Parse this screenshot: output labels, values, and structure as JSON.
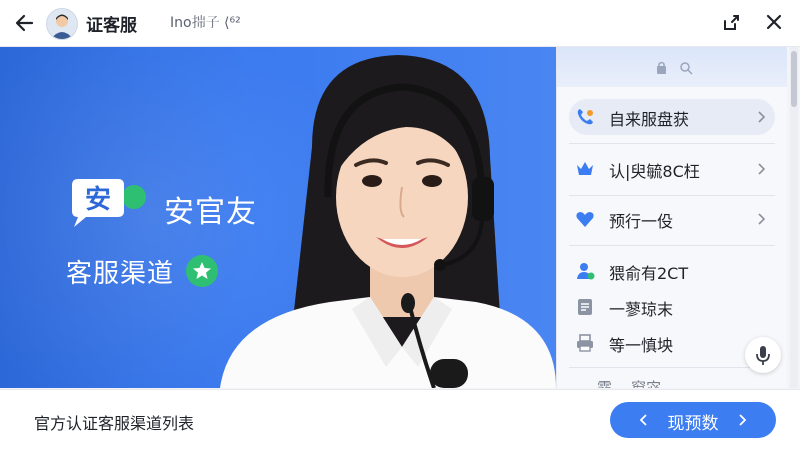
{
  "header": {
    "title": "证客服",
    "subtitle": "Ino𢭍子 ⟨⁶²",
    "icons": [
      "back-arrow-icon",
      "avatar",
      "share-icon",
      "close-icon"
    ]
  },
  "banner": {
    "logo_glyph": "安",
    "brand_name": "安官友",
    "channel_label": "客服渠道",
    "badge_icon": "star-icon",
    "colors": {
      "background": "#3a7af0",
      "logo_green": "#2fbf73"
    }
  },
  "panel": {
    "header_icons": [
      "lock-icon",
      "user-search-icon"
    ],
    "items": [
      {
        "label": "自来服盘获",
        "icon": "phone-icon",
        "chevron": true,
        "active": true
      },
      {
        "label": "认|臾毓8C枉",
        "icon": "crown-icon",
        "chevron": true,
        "active": false
      },
      {
        "label": "预行一伇",
        "icon": "heart-icon",
        "chevron": true,
        "active": false
      },
      {
        "label": "猥俞有2CT",
        "icon": "user-check-icon",
        "chevron": false,
        "active": false
      },
      {
        "label": "一蓼琼末",
        "icon": "document-icon",
        "chevron": false,
        "active": false
      },
      {
        "label": "等一慎坱",
        "icon": "print-icon",
        "chevron": false,
        "active": false
      }
    ],
    "cut_row": "霧... 窗宓",
    "mic_icon": "microphone-icon"
  },
  "footer": {
    "title": "官方认证客服渠道列表",
    "button_label": "现预数",
    "button_color": "#3d7df2"
  }
}
